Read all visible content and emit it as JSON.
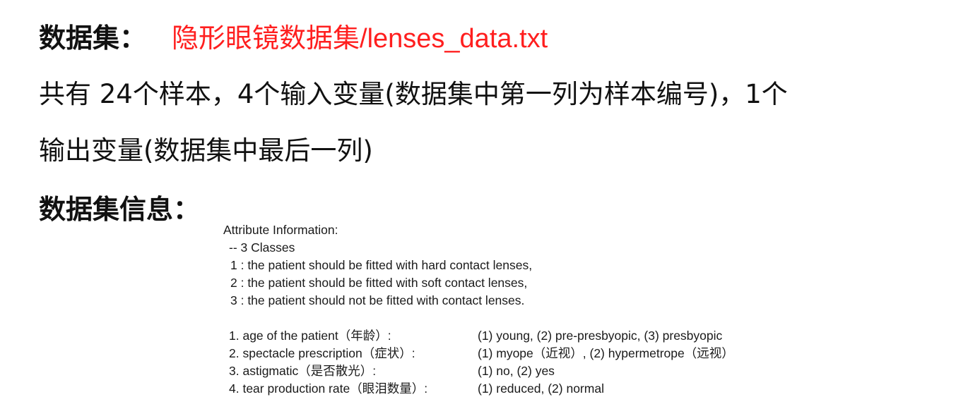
{
  "heading": {
    "label": "数据集：",
    "dataset_name": "隐形眼镜数据集/lenses_data.txt"
  },
  "description": {
    "line1": "共有 24个样本，4个输入变量(数据集中第一列为样本编号)，1个",
    "line2": "输出变量(数据集中最后一列)"
  },
  "info_heading": "数据集信息：",
  "attribute_info": {
    "title": "Attribute Information:",
    "classes_header": "-- 3 Classes",
    "classes": [
      "1 : the patient should be fitted with hard contact lenses,",
      "2 : the patient should be fitted with soft contact lenses,",
      "3 : the patient should not be fitted with contact lenses."
    ],
    "attributes": [
      {
        "name": "1. age of the patient（年龄）:",
        "values": "(1) young, (2) pre-presbyopic, (3) presbyopic"
      },
      {
        "name": "2. spectacle prescription（症状）:",
        "values": "(1) myope（近视）, (2) hypermetrope（远视）"
      },
      {
        "name": "3. astigmatic（是否散光）:",
        "values": "(1) no, (2) yes"
      },
      {
        "name": "4. tear production rate（眼泪数量）:",
        "values": "(1) reduced, (2) normal"
      }
    ]
  }
}
